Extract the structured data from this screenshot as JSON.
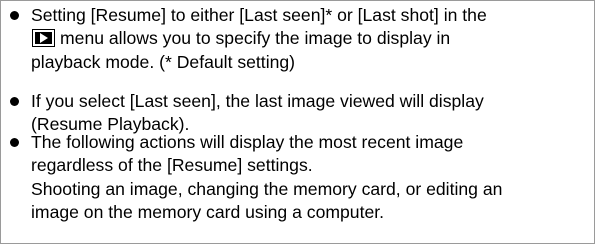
{
  "bullets": [
    {
      "line1": "Setting [Resume] to either [Last seen]* or [Last shot] in the",
      "line2_after_icon": "menu allows you to specify the image to display in",
      "line3": "playback mode. (* Default setting)",
      "icon": "playback-menu-icon"
    },
    {
      "text": "If you select [Last seen], the last image viewed will display\n(Resume Playback)."
    },
    {
      "text": "The following actions will display the most recent image\nregardless of the [Resume] settings.\nShooting an image, changing the memory card, or editing an\nimage on the memory card using a computer."
    }
  ]
}
